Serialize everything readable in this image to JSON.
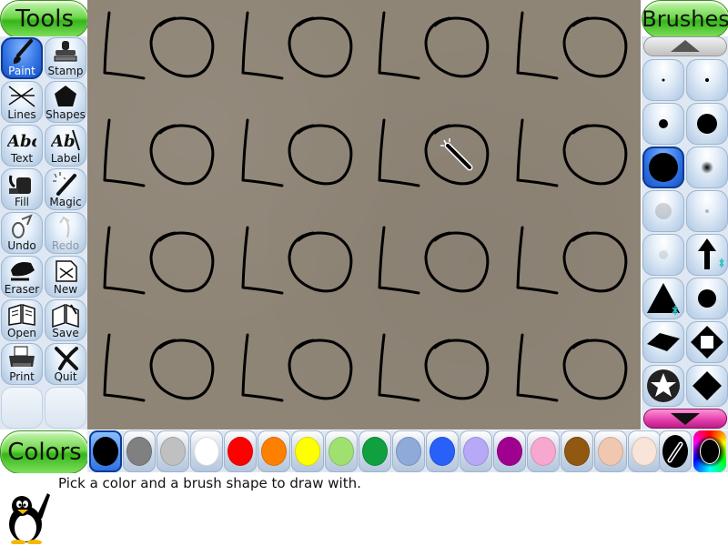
{
  "tools_panel": {
    "title": "Tools",
    "items": [
      {
        "label": "Paint",
        "icon": "paintbrush-icon",
        "selected": true
      },
      {
        "label": "Stamp",
        "icon": "stamp-icon"
      },
      {
        "label": "Lines",
        "icon": "lines-icon"
      },
      {
        "label": "Shapes",
        "icon": "pentagon-icon"
      },
      {
        "label": "Text",
        "icon": "text-icon"
      },
      {
        "label": "Label",
        "icon": "label-icon"
      },
      {
        "label": "Fill",
        "icon": "paint-bucket-icon"
      },
      {
        "label": "Magic",
        "icon": "magic-wand-icon"
      },
      {
        "label": "Undo",
        "icon": "undo-icon"
      },
      {
        "label": "Redo",
        "icon": "redo-icon",
        "disabled": true
      },
      {
        "label": "Eraser",
        "icon": "eraser-icon"
      },
      {
        "label": "New",
        "icon": "new-document-icon"
      },
      {
        "label": "Open",
        "icon": "open-book-icon"
      },
      {
        "label": "Save",
        "icon": "save-book-icon"
      },
      {
        "label": "Print",
        "icon": "printer-icon"
      },
      {
        "label": "Quit",
        "icon": "quit-x-icon"
      }
    ]
  },
  "brushes_panel": {
    "title": "Brushes",
    "items": [
      {
        "icon": "tiny-dot-brush-icon"
      },
      {
        "icon": "tiny-dot-brush-icon"
      },
      {
        "icon": "small-dot-brush-icon"
      },
      {
        "icon": "medium-dot-brush-icon"
      },
      {
        "icon": "large-dot-brush-icon",
        "selected": true
      },
      {
        "icon": "fuzzy-dot-brush-icon"
      },
      {
        "icon": "faint-dot-brush-icon"
      },
      {
        "icon": "faint-small-dot-brush-icon"
      },
      {
        "icon": "faint-dot-brush-icon"
      },
      {
        "icon": "arrow-up-brush-icon"
      },
      {
        "icon": "triangle-brush-icon"
      },
      {
        "icon": "round-dot-brush-icon"
      },
      {
        "icon": "diamond-flat-brush-icon"
      },
      {
        "icon": "diamond-square-brush-icon"
      },
      {
        "icon": "star-brush-icon"
      },
      {
        "icon": "diamond-brush-icon"
      }
    ]
  },
  "colors_panel": {
    "title": "Colors",
    "swatches": [
      {
        "name": "black",
        "hex": "#000000",
        "selected": true
      },
      {
        "name": "gray",
        "hex": "#808080"
      },
      {
        "name": "silver",
        "hex": "#c0c0c0"
      },
      {
        "name": "white",
        "hex": "#ffffff"
      },
      {
        "name": "red",
        "hex": "#ff0000"
      },
      {
        "name": "orange",
        "hex": "#ff8000"
      },
      {
        "name": "yellow",
        "hex": "#ffff00"
      },
      {
        "name": "light-green",
        "hex": "#a0e070"
      },
      {
        "name": "green",
        "hex": "#10a040"
      },
      {
        "name": "light-blue",
        "hex": "#8fa9d8"
      },
      {
        "name": "blue",
        "hex": "#2860f8"
      },
      {
        "name": "lavender",
        "hex": "#b8a8f8"
      },
      {
        "name": "purple",
        "hex": "#a00090"
      },
      {
        "name": "pink",
        "hex": "#f8a8d0"
      },
      {
        "name": "brown",
        "hex": "#905810"
      },
      {
        "name": "tan",
        "hex": "#f0c8b0"
      },
      {
        "name": "cream",
        "hex": "#f8e4d8"
      }
    ],
    "special": [
      {
        "name": "color-picker",
        "icon": "eyedropper-icon"
      },
      {
        "name": "rainbow-picker",
        "icon": "rainbow-picker-icon"
      }
    ]
  },
  "canvas": {
    "background": "#8f8577",
    "stroke": "#000000",
    "content": "hand-drawn L and O shapes repeated in a 4x4 grid",
    "cursor": "magic-wand-cursor-icon"
  },
  "status": {
    "message": "Pick a color and a brush shape to draw with.",
    "mascot": "tux-penguin-icon"
  }
}
